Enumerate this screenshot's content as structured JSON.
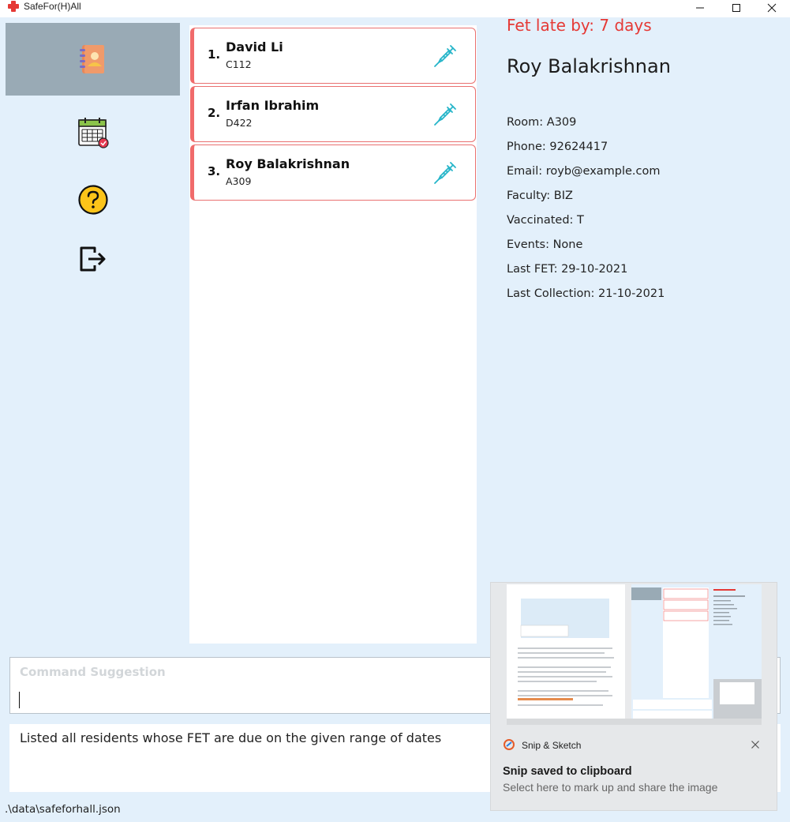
{
  "window": {
    "title": "SafeFor(H)All"
  },
  "nav": [
    {
      "name": "residents",
      "icon": "contact-book-icon",
      "active": true
    },
    {
      "name": "events",
      "icon": "calendar-icon",
      "active": false
    },
    {
      "name": "help",
      "icon": "help-question-icon",
      "active": false
    },
    {
      "name": "exit",
      "icon": "exit-icon",
      "active": false
    }
  ],
  "residents": [
    {
      "index": "1.",
      "name": "David Li",
      "room": "C112",
      "icon": "syringe-icon"
    },
    {
      "index": "2.",
      "name": "Irfan Ibrahim",
      "room": "D422",
      "icon": "syringe-icon"
    },
    {
      "index": "3.",
      "name": "Roy Balakrishnan",
      "room": "A309",
      "icon": "syringe-icon"
    }
  ],
  "detail": {
    "status": "Fet late by: 7 days",
    "name": "Roy Balakrishnan",
    "fields": [
      "Room: A309",
      "Phone: 92624417",
      "Email: royb@example.com",
      "Faculty: BIZ",
      "Vaccinated: T",
      "Events: None",
      "Last FET: 29-10-2021",
      "Last Collection: 21-10-2021"
    ]
  },
  "command": {
    "placeholder": "Command Suggestion",
    "value": ""
  },
  "result": {
    "text": "Listed all residents whose FET are due on the given range of dates"
  },
  "status_bar": {
    "path": ".\\data\\safeforhall.json"
  },
  "notification": {
    "app": "Snip & Sketch",
    "title": "Snip saved to clipboard",
    "body": "Select here to mark up and share the image"
  },
  "colors": {
    "accent_red": "#e53935",
    "card_border": "#f06b6b",
    "background": "#e3f0fb",
    "nav_active": "#99aab5",
    "syringe": "#26b5c9"
  }
}
